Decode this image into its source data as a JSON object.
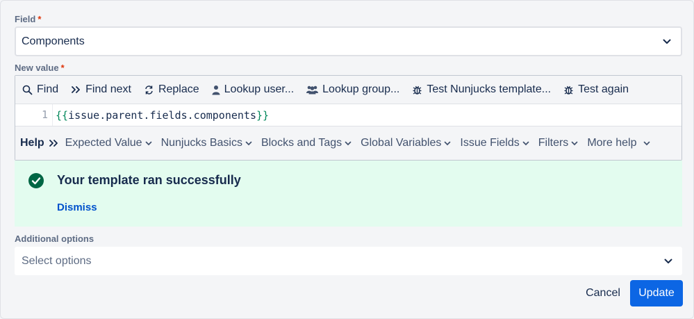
{
  "field": {
    "label": "Field",
    "required_mark": "*",
    "value": "Components"
  },
  "new_value": {
    "label": "New value",
    "required_mark": "*"
  },
  "toolbar": {
    "find": "Find",
    "find_next": "Find next",
    "replace": "Replace",
    "lookup_user": "Lookup user...",
    "lookup_group": "Lookup group...",
    "test_template": "Test Nunjucks template...",
    "test_again": "Test again"
  },
  "editor": {
    "line_number": "1",
    "open_braces": "{{",
    "expression": "issue.parent.fields.components",
    "close_braces": "}}"
  },
  "help": {
    "title": "Help",
    "menus": [
      "Expected Value",
      "Nunjucks Basics",
      "Blocks and Tags",
      "Global Variables",
      "Issue Fields",
      "Filters",
      "More help"
    ]
  },
  "status": {
    "message": "Your template ran successfully",
    "dismiss": "Dismiss",
    "color": "#e3fcef",
    "icon_color": "#006644"
  },
  "additional_options": {
    "label": "Additional options",
    "placeholder": "Select options"
  },
  "actions": {
    "cancel": "Cancel",
    "update": "Update",
    "primary_color": "#0c66e4"
  }
}
